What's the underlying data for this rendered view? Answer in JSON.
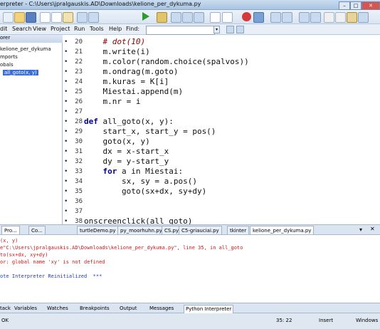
{
  "window": {
    "title": "erpreter - C:\\Users\\jpralgauskis.AD\\Downloads\\kelione_per_dykuma.py"
  },
  "menu": {
    "items": [
      "dit",
      "Search",
      "View",
      "Project",
      "Run",
      "Tools",
      "Help"
    ],
    "find_label": "Find:"
  },
  "left_panel": {
    "header": "orer",
    "items": [
      "kelione_per_dykuma",
      "mports",
      "obals",
      "all_goto(x, y)"
    ],
    "tabs": [
      "Pro...",
      "Co..."
    ]
  },
  "editor": {
    "lines": [
      {
        "n": "20",
        "text": "    # dot(10)"
      },
      {
        "n": "21",
        "text": "    m.write(i)"
      },
      {
        "n": "22",
        "text": "    m.color(random.choice(spalvos))"
      },
      {
        "n": "23",
        "text": "    m.ondrag(m.goto)"
      },
      {
        "n": "24",
        "text": "    m.kuras = K[i]"
      },
      {
        "n": "25",
        "text": "    Miestai.append(m)"
      },
      {
        "n": "26",
        "text": "    m.nr = i"
      },
      {
        "n": "27",
        "text": ""
      },
      {
        "n": "28",
        "text": "def all_goto(x, y):"
      },
      {
        "n": "29",
        "text": "    start_x, start_y = pos()"
      },
      {
        "n": "30",
        "text": "    goto(x, y)"
      },
      {
        "n": "31",
        "text": "    dx = x-start_x"
      },
      {
        "n": "32",
        "text": "    dy = y-start_y"
      },
      {
        "n": "33",
        "text": "    for a in Miestai:"
      },
      {
        "n": "34",
        "text": "        sx, sy = a.pos()"
      },
      {
        "n": "35",
        "text": "        goto(sx+dx, sy+dy)"
      },
      {
        "n": "36",
        "text": ""
      },
      {
        "n": "37",
        "text": ""
      },
      {
        "n": "38",
        "text": "onscreenclick(all_goto)"
      }
    ]
  },
  "file_tabs": [
    "turtleDemo.py",
    "py_moorhuhn.py",
    "CS.py",
    "C5-griauciai.py",
    "tkinter",
    "kelione_per_dykuma.py"
  ],
  "output": {
    "lines": [
      "(x, y)",
      "e\"C:\\Users\\jpralgauskis.AD\\Downloads\\kelione_per_dykuma.py\", line 35, in all_goto",
      "to(sx+dx, xy+dy)",
      "or: global name 'xy' is not defined",
      "",
      "ote Interpreter Reinitialized  ***"
    ]
  },
  "bottom_tabs": [
    "tack",
    "Variables",
    "Watches",
    "Breakpoints",
    "Output",
    "Messages",
    "Python Interpreter"
  ],
  "status": {
    "left": "OK",
    "position": "35: 22",
    "mode": "Insert",
    "encoding": "Windows"
  }
}
